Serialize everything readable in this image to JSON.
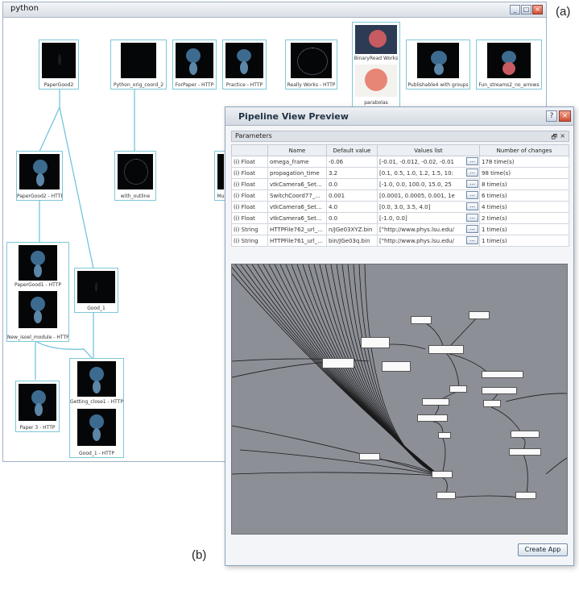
{
  "annotations": {
    "a": "(a)",
    "b": "(b)"
  },
  "main_window": {
    "title": "python",
    "controls": {
      "minimize": "_",
      "maximize": "□",
      "close": "×"
    },
    "nodes": {
      "papergood2": "PaperGood2",
      "python_orig": "Python_orig_coord_2",
      "forpaper": "ForPaper - HTTP",
      "practice": "Practice - HTTP",
      "really_works": "Really Works - HTTP",
      "binaryread": "BinaryRead Works",
      "parabolas": "parabolas",
      "publishable": "Publishable4 with groups",
      "fun_streams": "Fun_streams2_no_arrows",
      "papergood2_http": "PaperGood2 - HTTP",
      "with_outline": "with_outline",
      "mu": "Mu",
      "papergood1": "PaperGood1 - HTTP",
      "new_isoel": "New_isoel_module - HTTP",
      "good1": "Good_1",
      "paper3": "Paper 3 - HTTP",
      "getting_close": "Getting_close1 - HTTP",
      "good1_http": "Good_1 - HTTP"
    }
  },
  "preview_window": {
    "title": "Pipeline View Preview",
    "help": "?",
    "close": "×",
    "parameters_label": "Parameters",
    "panel_icons": {
      "float": "🗗",
      "close": "×"
    },
    "columns": [
      "",
      "Name",
      "Default value",
      "Values list",
      "Number of changes"
    ],
    "rows": [
      {
        "type": "(i) Float",
        "name": "omega_frame",
        "default": "-0.06",
        "values": "[-0.01, -0.012, -0.02, -0.01",
        "changes": "178 time(s)"
      },
      {
        "type": "(i) Float",
        "name": "propagation_time",
        "default": "3.2",
        "values": "[0.1, 0.5, 1.0, 1.2, 1.5, 10:",
        "changes": "98 time(s)"
      },
      {
        "type": "(i) Float",
        "name": "vtkCamera6_Set...",
        "default": "0.0",
        "values": "[-1.0, 0.0, 100.0, 15.0, 25",
        "changes": "8 time(s)"
      },
      {
        "type": "(i) Float",
        "name": "SwitchCoord77_...",
        "default": "0.001",
        "values": "[0.0001, 0.0005, 0.001, 1e",
        "changes": "6 time(s)"
      },
      {
        "type": "(i) Float",
        "name": "vtkCamera6_Set...",
        "default": "4.0",
        "values": "[0.0, 3.0, 3.5, 4.0]",
        "changes": "4 time(s)"
      },
      {
        "type": "(i) Float",
        "name": "vtkCamera6_Set...",
        "default": "0.0",
        "values": "[-1.0, 0.0]",
        "changes": "2 time(s)"
      },
      {
        "type": "(i) String",
        "name": "HTTPFile762_url_...",
        "default": "n/JGe03XYZ.bin",
        "values": "[\"http://www.phys.lsu.edu/",
        "changes": "1 time(s)"
      },
      {
        "type": "(i) String",
        "name": "HTTPFile761_url_...",
        "default": "bin/JGe03q.bin",
        "values": "[\"http://www.phys.lsu.edu/",
        "changes": "1 time(s)"
      }
    ],
    "dots_label": "...",
    "create_app": "Create App"
  }
}
